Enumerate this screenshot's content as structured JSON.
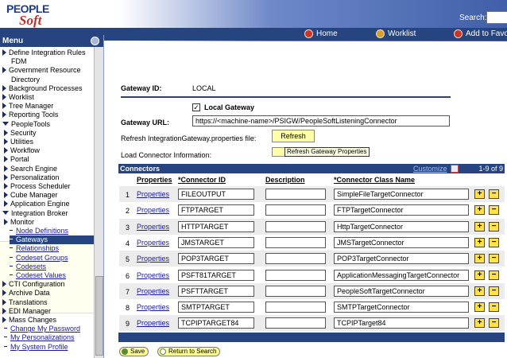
{
  "header": {
    "logo_top": "PEOPLE",
    "logo_bottom": "Soft",
    "search_label": "Search:",
    "nav": [
      {
        "label": "Home",
        "icon": "home-icon"
      },
      {
        "label": "Worklist",
        "icon": "worklist-icon"
      },
      {
        "label": "Add to Favo",
        "icon": "favorites-icon"
      }
    ]
  },
  "menu": {
    "title": "Menu",
    "items": [
      {
        "label": "Define Integration Rules",
        "type": "folder"
      },
      {
        "label": "FDM",
        "type": "plain"
      },
      {
        "label": "Government Resource",
        "type": "folder"
      },
      {
        "label": "Directory",
        "type": "plain"
      },
      {
        "label": "Background Processes",
        "type": "folder"
      },
      {
        "label": "Worklist",
        "type": "folder"
      },
      {
        "label": "Tree Manager",
        "type": "folder"
      },
      {
        "label": "Reporting Tools",
        "type": "folder"
      },
      {
        "label": "PeopleTools",
        "type": "open"
      },
      {
        "label": "Security",
        "type": "folder"
      },
      {
        "label": "Utilities",
        "type": "folder"
      },
      {
        "label": "Workflow",
        "type": "folder"
      },
      {
        "label": "Portal",
        "type": "folder"
      },
      {
        "label": "Search Engine",
        "type": "folder"
      },
      {
        "label": "Personalization",
        "type": "folder"
      },
      {
        "label": "Process Scheduler",
        "type": "folder"
      },
      {
        "label": "Cube Manager",
        "type": "folder"
      },
      {
        "label": "Application Engine",
        "type": "folder"
      },
      {
        "label": "Integration Broker",
        "type": "open"
      },
      {
        "label": "Monitor",
        "type": "folder"
      },
      {
        "label": "Node Definitions",
        "type": "sub"
      },
      {
        "label": "Gateways",
        "type": "active"
      },
      {
        "label": "Relationships",
        "type": "sub"
      },
      {
        "label": "Codeset Groups",
        "type": "sub"
      },
      {
        "label": "Codesets",
        "type": "sub"
      },
      {
        "label": "Codeset Values",
        "type": "sub"
      },
      {
        "label": "CTI Configuration",
        "type": "folder"
      },
      {
        "label": "Archive Data",
        "type": "folder"
      },
      {
        "label": "Translations",
        "type": "folder"
      },
      {
        "label": "EDI Manager",
        "type": "folder"
      },
      {
        "label": "Mass Changes",
        "type": "folder"
      },
      {
        "label": "Change My Password",
        "type": "link"
      },
      {
        "label": "My Personalizations",
        "type": "link"
      },
      {
        "label": "My System Profile",
        "type": "link"
      }
    ]
  },
  "form": {
    "gateway_id_label": "Gateway ID:",
    "gateway_id_value": "LOCAL",
    "local_gateway_label": "Local Gateway",
    "local_gateway_checked": true,
    "gateway_url_label": "Gateway URL:",
    "gateway_url_value": "https://<machine-name>/PSIGW/PeopleSoftListeningConnector",
    "refresh_label": "Refresh IntegrationGateway.properties file:",
    "refresh_button": "Refresh",
    "load_label": "Load Connector Information:",
    "tooltip": "Refresh Gateway Properties"
  },
  "grid": {
    "title": "Connectors",
    "customize": "Customize",
    "count": "1-9 of 9",
    "columns": [
      "Properties",
      "*Connector ID",
      "Description",
      "*Connector Class Name"
    ],
    "rows": [
      {
        "num": "1",
        "prop": "Properties",
        "id": "FILEOUTPUT",
        "desc": "",
        "cls": "SimpleFileTargetConnector"
      },
      {
        "num": "2",
        "prop": "Properties",
        "id": "FTPTARGET",
        "desc": "",
        "cls": "FTPTargetConnector"
      },
      {
        "num": "3",
        "prop": "Properties",
        "id": "HTTPTARGET",
        "desc": "",
        "cls": "HttpTargetConnector"
      },
      {
        "num": "4",
        "prop": "Properties",
        "id": "JMSTARGET",
        "desc": "",
        "cls": "JMSTargetConnector"
      },
      {
        "num": "5",
        "prop": "Properties",
        "id": "POP3TARGET",
        "desc": "",
        "cls": "POP3TargetConnector"
      },
      {
        "num": "6",
        "prop": "Properties",
        "id": "PSFT81TARGET",
        "desc": "",
        "cls": "ApplicationMessagingTargetConnector"
      },
      {
        "num": "7",
        "prop": "Properties",
        "id": "PSFTTARGET",
        "desc": "",
        "cls": "PeopleSoftTargetConnector"
      },
      {
        "num": "8",
        "prop": "Properties",
        "id": "SMTPTARGET",
        "desc": "",
        "cls": "SMTPTargetConnector"
      },
      {
        "num": "9",
        "prop": "Properties",
        "id": "TCPIPTARGET84",
        "desc": "",
        "cls": "TCPIPTarget84"
      }
    ]
  },
  "footer": {
    "save": "Save",
    "return": "Return to Search"
  }
}
